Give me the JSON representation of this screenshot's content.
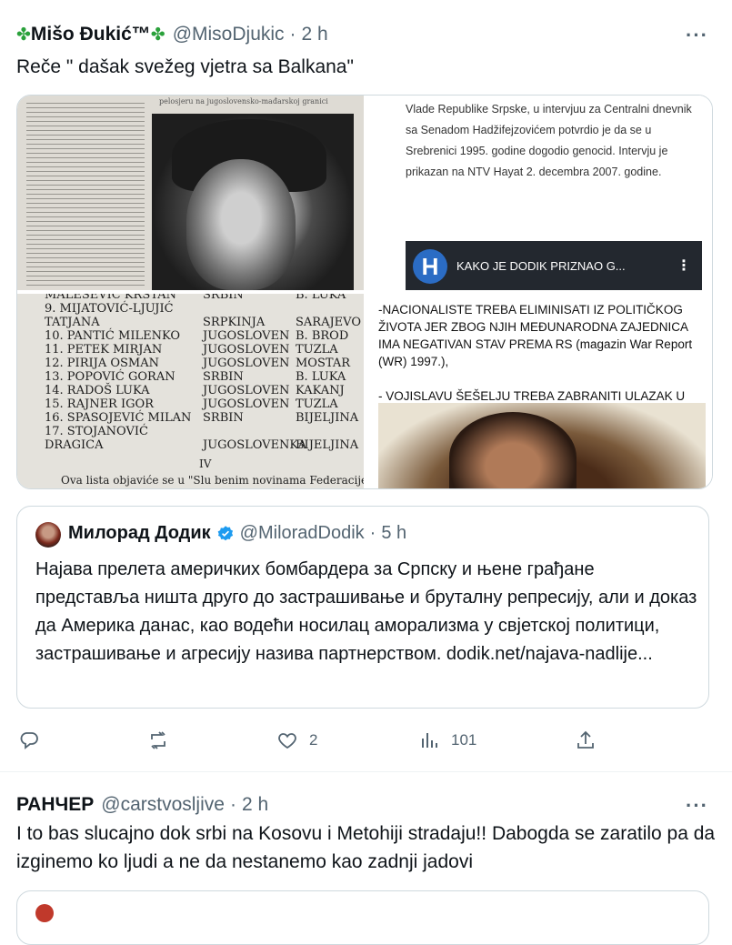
{
  "tweet1": {
    "author_name": "Mišo Đukić™",
    "author_emoji": "clover-icon",
    "handle": "@MisoDjukic",
    "time": "2 h",
    "text": "Reče \" dašak svežeg vjetra sa Balkana\"",
    "media": {
      "clipping_caption": "pelosjeru na jugoslovensko-mađarskoj granici",
      "article_text": "Vlade Republike Srpske, u intervjuu za Centralni dnevnik sa Senadom Hadžifejzovićem potvrdio je da se u Srebrenici 1995. godine dogodio genocid. Intervju je prikazan na NTV Hayat 2. decembra 2007. godine.",
      "video_logo": "H",
      "video_title": "KAKO JE DODIK PRIZNAO G...",
      "list_rows": [
        {
          "name": "MALEŠEVIĆ KRSTAN",
          "people": "SRBIN",
          "city": "B. LUKA"
        },
        {
          "name": "9.  MIJATOVIĆ-LJUJIĆ",
          "people": "",
          "city": ""
        },
        {
          "name": "     TATJANA",
          "people": "SRPKINJA",
          "city": "SARAJEVO"
        },
        {
          "name": "10. PANTIĆ MILENKO",
          "people": "JUGOSLOVEN",
          "city": "B. BROD"
        },
        {
          "name": "11. PETEK MIRJAN",
          "people": "JUGOSLOVEN",
          "city": "TUZLA"
        },
        {
          "name": "12. PIRIJA OSMAN",
          "people": "JUGOSLOVEN",
          "city": "MOSTAR"
        },
        {
          "name": "13. POPOVIĆ GORAN",
          "people": "SRBIN",
          "city": "B. LUKA"
        },
        {
          "name": "14. RADOŠ LUKA",
          "people": "JUGOSLOVEN",
          "city": "KAKANJ"
        },
        {
          "name": "15. RAJNER IGOR",
          "people": "JUGOSLOVEN",
          "city": "TUZLA"
        },
        {
          "name": "16. SPASOJEVIĆ MILAN",
          "people": "SRBIN",
          "city": "BIJELJINA"
        },
        {
          "name": "17. STOJANOVIĆ",
          "people": "",
          "city": ""
        },
        {
          "name": "     DRAGICA",
          "people": "JUGOSLOVENKA",
          "city": "BIJELJINA"
        }
      ],
      "list_page": "IV",
      "list_footer": "Ova lista objaviće se u \"Slu benim novinama Federacije",
      "report_text": "-NACIONALISTE TREBA ELIMINISATI IZ POLITIČKOG ŽIVOTA JER ZBOG NJIH MEĐUNARODNA ZAJEDNICA IMA NEGATIVAN STAV PREMA RS (magazin War Report (WR) 1997.),\n\n- VOJISLAVU ŠEŠELJU TREBA ZABRANITI ULAZAK U RS,"
    },
    "quote": {
      "author_name": "Милорад Додик",
      "handle": "@MiloradDodik",
      "time": "5 h",
      "text": "Најава прелета америчких бомбардера за Српску и њене грађане представља ништа друго до застрашивање и бруталну репресију, али и доказ да Америка данас, као водећи носилац аморализма у свјетској политици, застрашивање и агресију назива партнерством. dodik.net/najava-nadlije..."
    },
    "actions": {
      "replies": "",
      "reposts": "",
      "likes": "2",
      "views": "101"
    }
  },
  "tweet2": {
    "author_name": "РАНЧЕР",
    "handle": "@carstvosljive",
    "time": "2 h",
    "text": "I to bas slucajno dok srbi na Kosovu i Metohiji stradaju!! Dabogda se zaratilo pa da izginemo ko ljudi a ne da nestanemo  kao zadnji jadovi"
  },
  "ui": {
    "more_label": "···",
    "dot": "·",
    "accent": "#1d9bf0",
    "muted": "#536471",
    "border": "#cfd9de"
  }
}
